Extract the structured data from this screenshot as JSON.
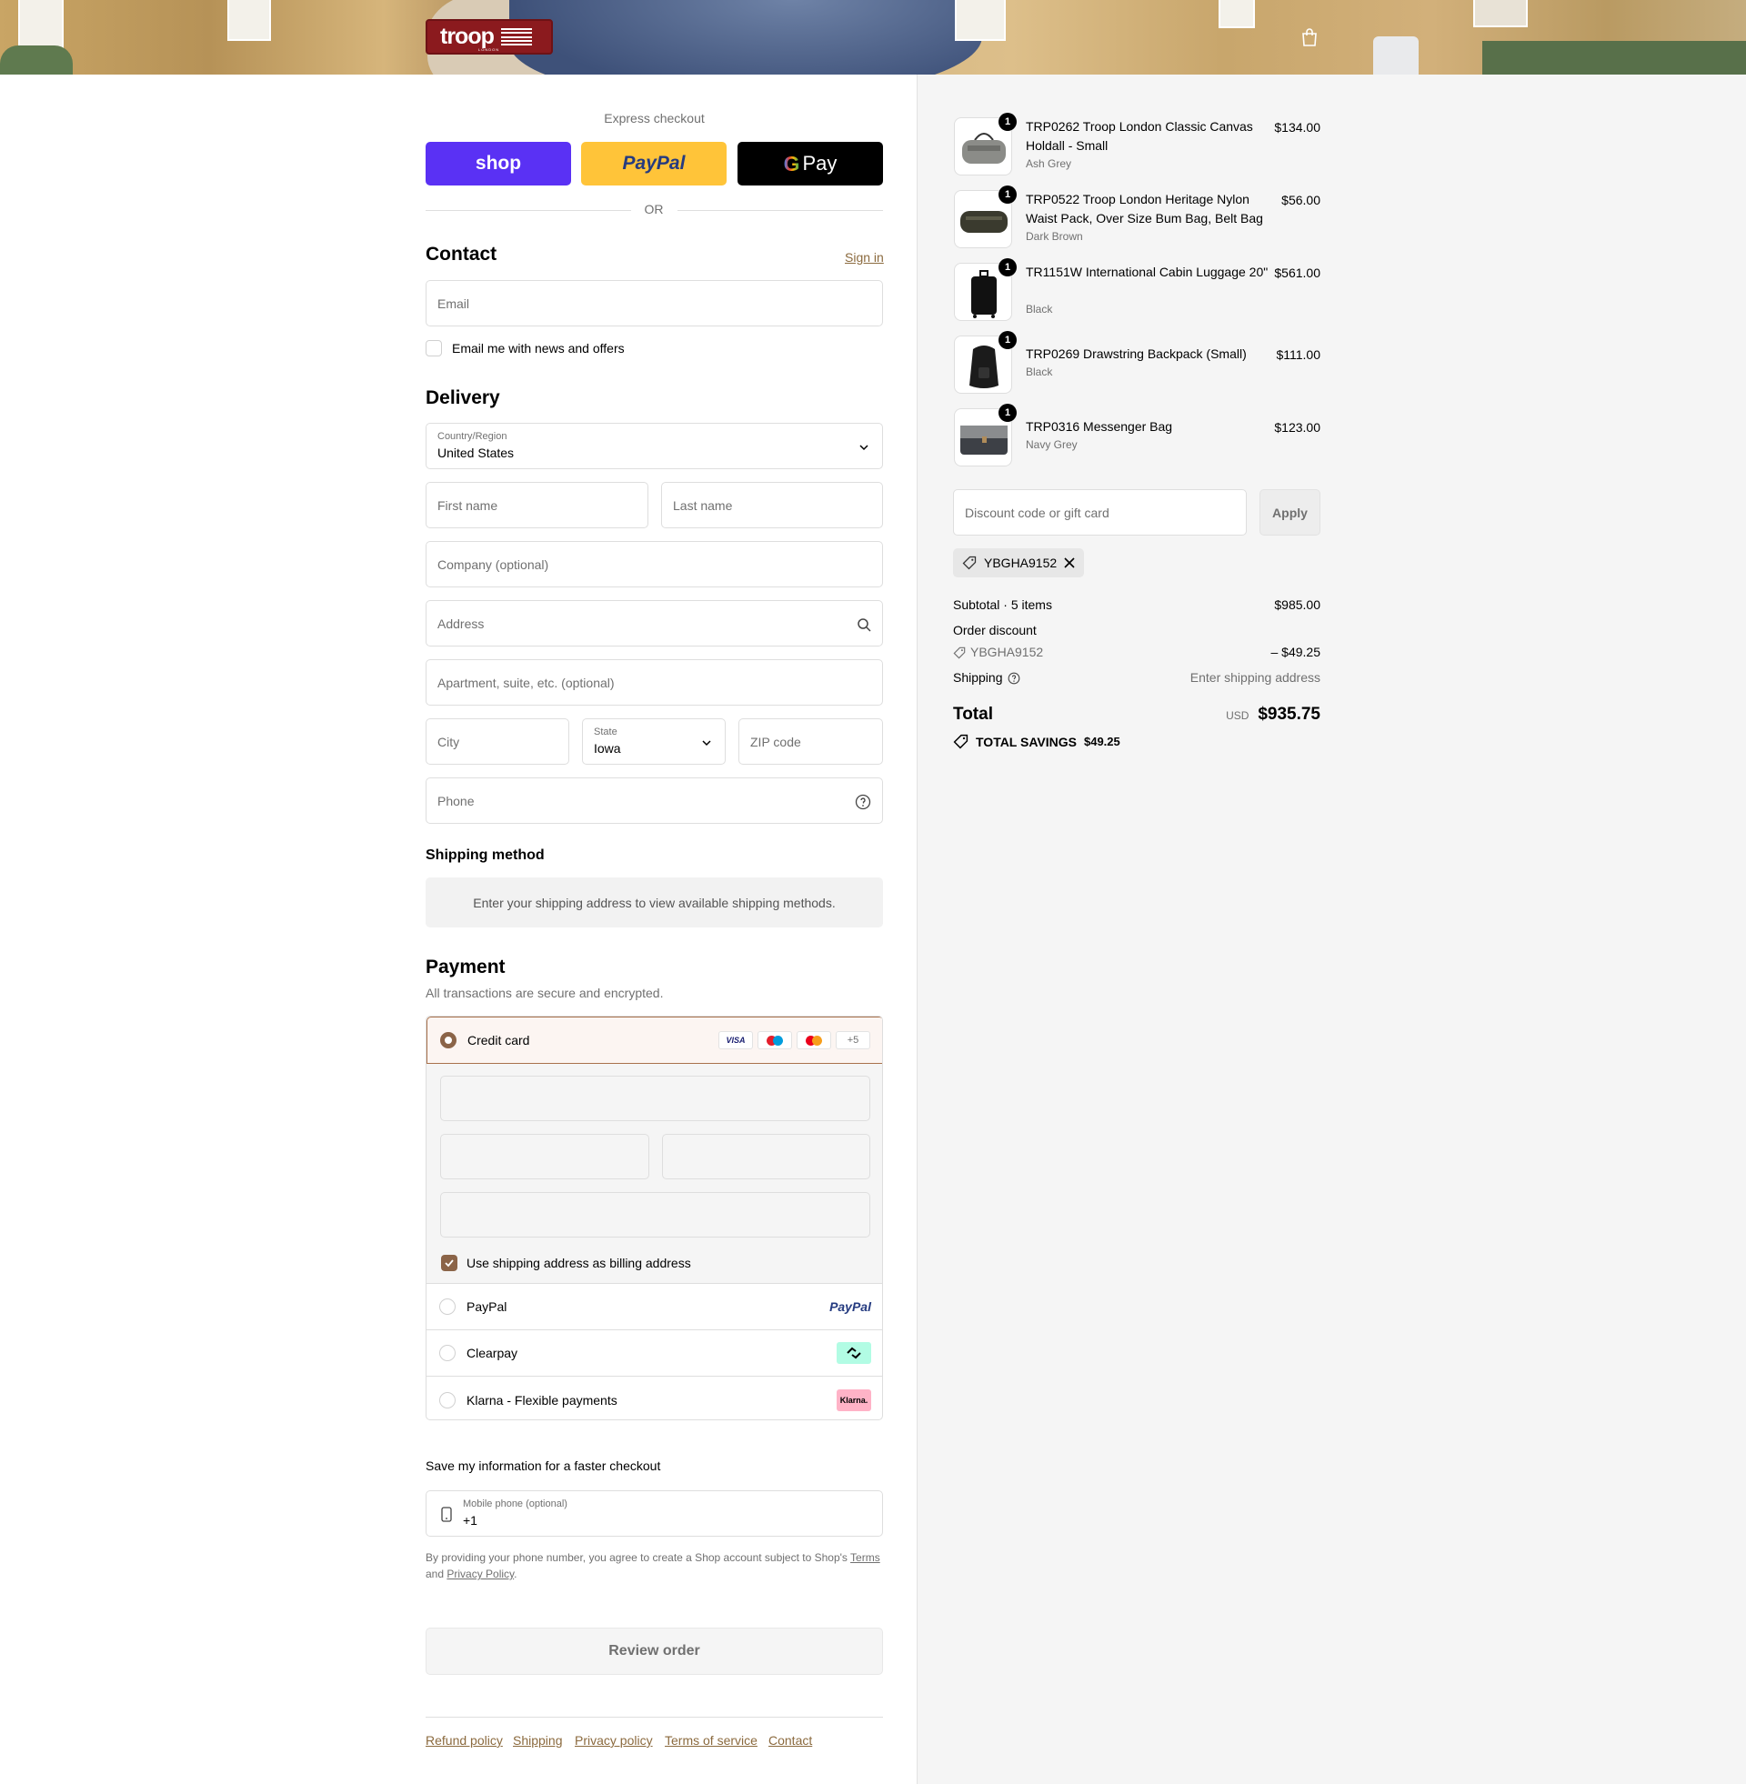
{
  "header": {
    "logo_text": "troop",
    "logo_sub": "LONDON",
    "cart_icon": "shopping-bag-icon"
  },
  "express": {
    "label": "Express checkout",
    "shop_label": "shop",
    "paypal_label": "PayPal",
    "gpay_label": "Pay",
    "or_label": "OR"
  },
  "contact": {
    "title": "Contact",
    "sign_in": "Sign in",
    "email_placeholder": "Email",
    "newsletter_label": "Email me with news and offers"
  },
  "delivery": {
    "title": "Delivery",
    "country_label": "Country/Region",
    "country_value": "United States",
    "first_name": "First name",
    "last_name": "Last name",
    "company": "Company (optional)",
    "address": "Address",
    "apartment": "Apartment, suite, etc. (optional)",
    "city": "City",
    "state_label": "State",
    "state_value": "Iowa",
    "zip": "ZIP code",
    "phone": "Phone"
  },
  "shipping_method": {
    "title": "Shipping method",
    "message": "Enter your shipping address to view available shipping methods."
  },
  "payment": {
    "title": "Payment",
    "subtitle": "All transactions are secure and encrypted.",
    "credit_card": "Credit card",
    "card_brands": [
      "VISA",
      "Maestro",
      "Mastercard",
      "+5"
    ],
    "billing_checkbox": "Use shipping address as billing address",
    "paypal": "PayPal",
    "paypal_logo": "PayPal",
    "clearpay": "Clearpay",
    "klarna": "Klarna - Flexible payments",
    "klarna_logo": "Klarna."
  },
  "save_info": {
    "title": "Save my information for a faster checkout",
    "mobile_label": "Mobile phone (optional)",
    "mobile_value": "+1",
    "legal_1": "By providing your phone number, you agree to create a Shop account subject to Shop's",
    "terms": "Terms",
    "legal_and": "and",
    "privacy": "Privacy Policy",
    "legal_end": "."
  },
  "review_button": "Review order",
  "footer": [
    "Refund policy",
    "Shipping",
    "Privacy policy",
    "Terms of service",
    "Contact"
  ],
  "cart": {
    "items": [
      {
        "qty": "1",
        "name": "TRP0262 Troop London Classic Canvas Holdall - Small",
        "variant": "Ash Grey",
        "price": "$134.00"
      },
      {
        "qty": "1",
        "name": "TRP0522 Troop London Heritage Nylon Waist Pack, Over Size Bum Bag, Belt Bag",
        "variant": "Dark Brown",
        "price": "$56.00"
      },
      {
        "qty": "1",
        "name": "TR1151W International Cabin Luggage 20\"",
        "variant": "Black",
        "price": "$561.00"
      },
      {
        "qty": "1",
        "name": "TRP0269 Drawstring Backpack (Small)",
        "variant": "Black",
        "price": "$111.00"
      },
      {
        "qty": "1",
        "name": "TRP0316 Messenger Bag",
        "variant": "Navy Grey",
        "price": "$123.00"
      }
    ],
    "discount_placeholder": "Discount code or gift card",
    "apply": "Apply",
    "code_chip": "YBGHA9152",
    "subtotal_label": "Subtotal · 5 items",
    "subtotal_value": "$985.00",
    "order_discount_label": "Order discount",
    "discount_code": "YBGHA9152",
    "discount_value": "– $49.25",
    "shipping_label": "Shipping",
    "shipping_value": "Enter shipping address",
    "total_label": "Total",
    "currency": "USD",
    "total_value": "$935.75",
    "savings_label": "TOTAL SAVINGS",
    "savings_value": "$49.25"
  },
  "colors": {
    "accent": "#8b6a3e",
    "shop": "#5a31f4",
    "paypal": "#ffc439",
    "logo": "#8b1a1e"
  }
}
